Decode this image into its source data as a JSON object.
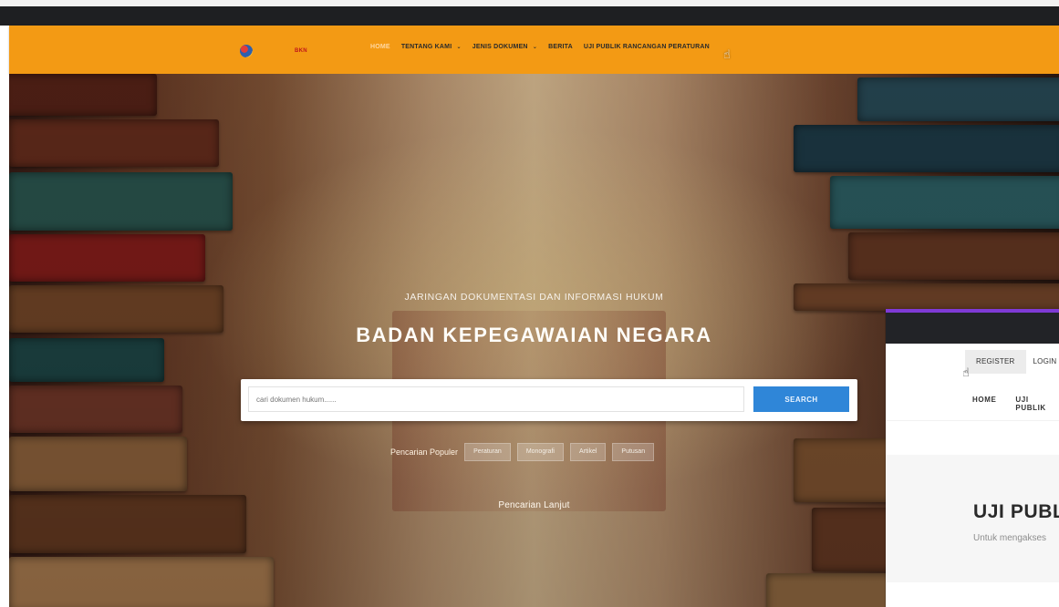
{
  "site": {
    "logo_bkn_text": "BKN",
    "nav": [
      {
        "label": "HOME",
        "caret": false
      },
      {
        "label": "TENTANG KAMI",
        "caret": true
      },
      {
        "label": "JENIS DOKUMEN",
        "caret": true
      },
      {
        "label": "BERITA",
        "caret": false
      },
      {
        "label": "UJI PUBLIK RANCANGAN PERATURAN",
        "caret": false
      }
    ]
  },
  "hero": {
    "kicker": "JARINGAN DOKUMENTASI DAN INFORMASI HUKUM",
    "title": "BADAN KEPEGAWAIAN NEGARA",
    "search": {
      "placeholder": "cari dokumen hukum......",
      "button": "SEARCH"
    },
    "popular_label": "Pencarian Populer",
    "chips": [
      "Peraturan",
      "Monografi",
      "Artikel",
      "Putusan"
    ],
    "advanced": "Pencarian Lanjut"
  },
  "inset": {
    "register": "REGISTER",
    "login": "LOGIN",
    "nav": [
      "HOME",
      "UJI PUBLIK"
    ],
    "heading": "UJI PUBLIK",
    "subtext": "Untuk mengakses"
  },
  "colors": {
    "nav_bg": "#f39a14",
    "search_btn": "#2f86d8",
    "inset_accent": "#7f3ad6"
  },
  "icons": {
    "cursor_main": "pointer-hand-icon",
    "cursor_inset": "pointer-hand-icon"
  }
}
